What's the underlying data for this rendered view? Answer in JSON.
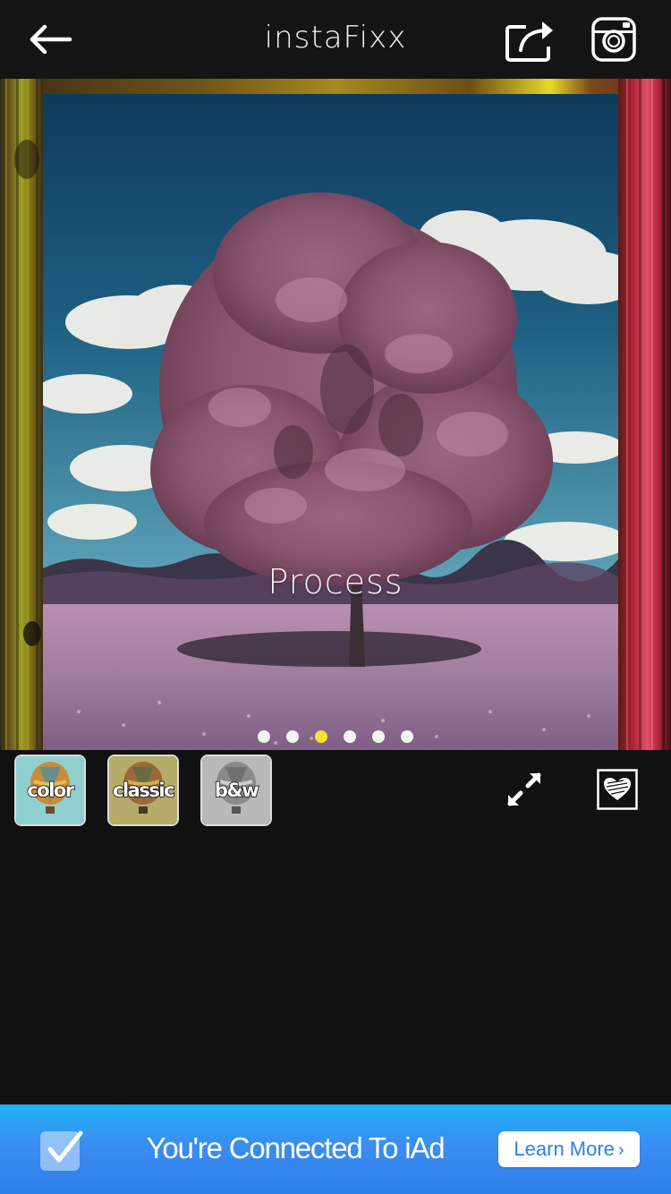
{
  "app": {
    "title": "instaFixx"
  },
  "header": {
    "back_icon": "arrow-left-icon",
    "share_icon": "share-export-icon",
    "instagram_icon": "instagram-camera-icon"
  },
  "photo": {
    "overlay_label": "Process",
    "page_dots": {
      "count": 6,
      "active_index": 2,
      "active_color": "#f6e431",
      "inactive_color": "#f4f4f4"
    }
  },
  "filters": [
    {
      "label": "color",
      "tint": "#8fd0cf"
    },
    {
      "label": "classic",
      "tint": "#b5ac6a"
    },
    {
      "label": "b&w",
      "tint": "#b9b9b9"
    }
  ],
  "tools": {
    "expand_icon": "expand-arrows-icon",
    "frame_icon": "heart-frame-icon"
  },
  "ad": {
    "icon": "checkmark-icon",
    "text": "You're Connected To iAd",
    "button_label": "Learn More",
    "button_chevron": "›",
    "accent": "#2f7fe9"
  },
  "colors": {
    "background": "#111111",
    "topbar": "#141414"
  }
}
